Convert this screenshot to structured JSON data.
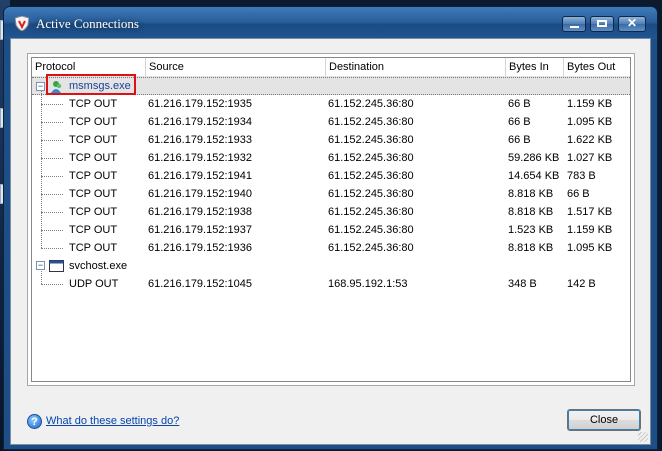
{
  "window": {
    "title": "Active Connections"
  },
  "columns": {
    "protocol": "Protocol",
    "source": "Source",
    "destination": "Destination",
    "bytes_in": "Bytes In",
    "bytes_out": "Bytes Out"
  },
  "groups": [
    {
      "name": "msmsgs.exe",
      "rows": [
        [
          "TCP OUT",
          "61.216.179.152:1935",
          "61.152.245.36:80",
          "66 B",
          "1.159 KB"
        ],
        [
          "TCP OUT",
          "61.216.179.152:1934",
          "61.152.245.36:80",
          "66 B",
          "1.095 KB"
        ],
        [
          "TCP OUT",
          "61.216.179.152:1933",
          "61.152.245.36:80",
          "66 B",
          "1.622 KB"
        ],
        [
          "TCP OUT",
          "61.216.179.152:1932",
          "61.152.245.36:80",
          "59.286 KB",
          "1.027 KB"
        ],
        [
          "TCP OUT",
          "61.216.179.152:1941",
          "61.152.245.36:80",
          "14.654 KB",
          "783 B"
        ],
        [
          "TCP OUT",
          "61.216.179.152:1940",
          "61.152.245.36:80",
          "8.818 KB",
          "66 B"
        ],
        [
          "TCP OUT",
          "61.216.179.152:1938",
          "61.152.245.36:80",
          "8.818 KB",
          "1.517 KB"
        ],
        [
          "TCP OUT",
          "61.216.179.152:1937",
          "61.152.245.36:80",
          "1.523 KB",
          "1.159 KB"
        ],
        [
          "TCP OUT",
          "61.216.179.152:1936",
          "61.152.245.36:80",
          "8.818 KB",
          "1.095 KB"
        ]
      ]
    },
    {
      "name": "svchost.exe",
      "rows": [
        [
          "UDP OUT",
          "61.216.179.152:1045",
          "168.95.192.1:53",
          "348 B",
          "142 B"
        ]
      ]
    }
  ],
  "footer": {
    "help_link": "What do these settings do?",
    "close_label": "Close"
  },
  "colors": {
    "titlebar": "#2a609d",
    "highlight_box": "#dd1111",
    "link": "#0645ad"
  }
}
